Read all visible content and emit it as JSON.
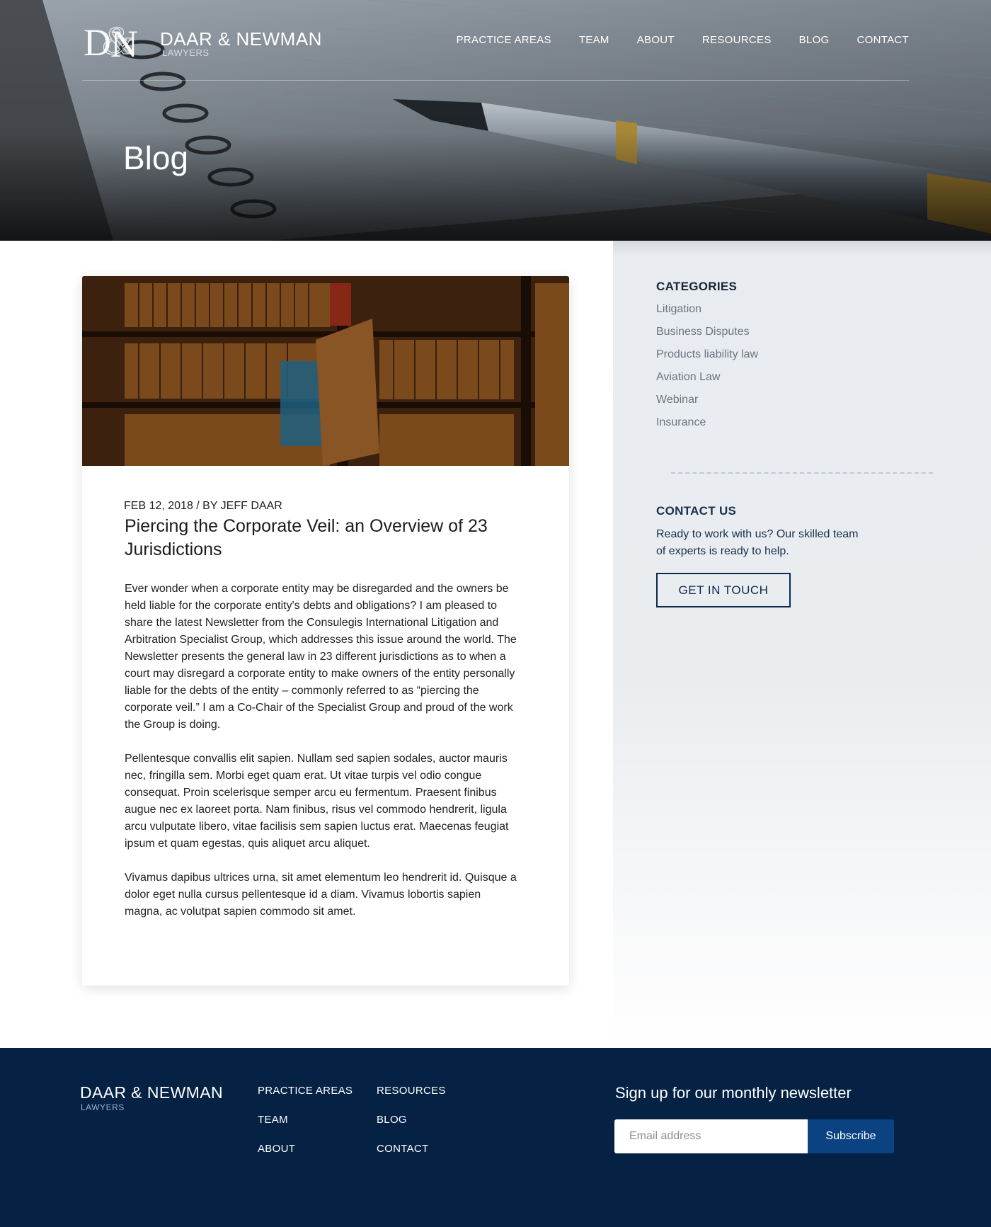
{
  "brand": {
    "name": "DAAR & NEWMAN",
    "subtitle": "LAWYERS",
    "monogram": "DN"
  },
  "nav": {
    "items": [
      "PRACTICE AREAS",
      "TEAM",
      "ABOUT",
      "RESOURCES",
      "BLOG",
      "CONTACT"
    ]
  },
  "hero": {
    "title": "Blog"
  },
  "post": {
    "meta": "FEB 12, 2018 / BY JEFF DAAR",
    "title": "Piercing the Corporate Veil: an Overview of 23 Jurisdictions",
    "paragraphs": [
      "Ever wonder when a corporate entity may be disregarded and the owners be held liable for the corporate entity's debts and obligations? I am pleased to share the latest Newsletter from the Consulegis International Litigation and Arbitration Specialist Group, which addresses this issue around the world. The Newsletter presents the general law in 23 different jurisdictions as to when a court may disregard a corporate entity to make owners of the entity personally liable for the debts of the entity – commonly referred to as “piercing the corporate veil.” I am a Co-Chair of the Specialist Group and proud of the work the Group is doing.",
      "Pellentesque convallis elit sapien. Nullam sed sapien sodales, auctor mauris nec, fringilla sem. Morbi eget quam erat. Ut vitae turpis vel odio congue consequat. Proin scelerisque semper arcu eu fermentum. Praesent finibus augue nec ex laoreet porta. Nam finibus, risus vel commodo hendrerit, ligula arcu vulputate libero, vitae facilisis sem sapien luctus erat. Maecenas feugiat ipsum et quam egestas, quis aliquet arcu aliquet.",
      "Vivamus dapibus ultrices urna, sit amet elementum leo hendrerit id. Quisque a dolor eget nulla cursus pellentesque id a diam. Vivamus lobortis sapien magna, ac volutpat sapien commodo sit amet."
    ]
  },
  "sidebar": {
    "categories_heading": "CATEGORIES",
    "categories": [
      "Litigation",
      "Business Disputes",
      "Products liability law",
      "Aviation Law",
      "Webinar",
      "Insurance"
    ],
    "contact_heading": "CONTACT US",
    "contact_text": "Ready to work with us? Our skilled team of experts is ready to help.",
    "contact_button": "GET IN TOUCH"
  },
  "footer": {
    "brand": "DAAR & NEWMAN",
    "brand_sub": "LAWYERS",
    "col1": [
      "PRACTICE AREAS",
      "TEAM",
      "ABOUT"
    ],
    "col2": [
      "RESOURCES",
      "BLOG",
      "CONTACT"
    ],
    "newsletter_heading": "Sign up for our monthly newsletter",
    "email_placeholder": "Email address",
    "subscribe_label": "Subscribe"
  },
  "colors": {
    "footer_bg": "#052144",
    "accent_button": "#0a4282",
    "sidebar_bg": "#e8ecf0",
    "heading_navy": "#1c2f4d"
  }
}
